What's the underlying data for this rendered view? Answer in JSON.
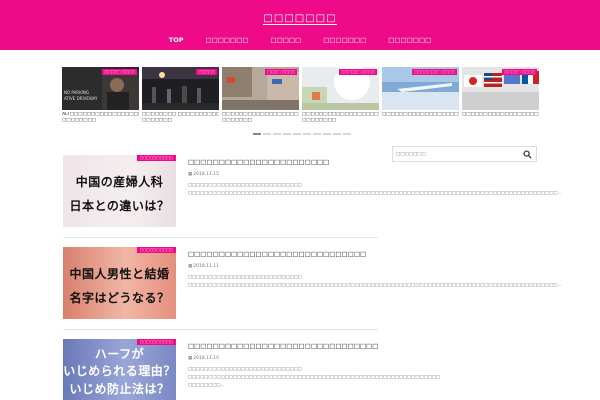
{
  "site": {
    "title": "□□□□□□□"
  },
  "nav": [
    "TOP",
    "□□□□□□□",
    "□□□□□",
    "□□□□□□□",
    "□□□□□□□"
  ],
  "slider": [
    {
      "category": "□□□□□ □□□□",
      "title": "ALT□□□□□□□□□□□□□□□□□□□□□",
      "title2": "□□□□□□□□",
      "overlay": "NO PARKING\nATIVE DRIVEWAY"
    },
    {
      "category": "□□□□□",
      "title": "□□□□□□□□ □□□□□□□□□□□□",
      "title2": "□□□□□□□"
    },
    {
      "category": "□□□□ □□□□",
      "title": "□□□□□□□□□□□□□□□□□□□□□□",
      "title2": "□□□□□□□"
    },
    {
      "category": "□□□□□□ □□□□",
      "title": "□□□□□□□□□□□□□□□□□□□□□□",
      "title2": "□□□□□□□□"
    },
    {
      "category": "□□□□□□□□ □□□□",
      "title": "□□□□□□□□□□□□□□□□□□□□□□",
      "title2": ""
    },
    {
      "category": "□□□□□ □□□□",
      "title": "□□□□□□□□□□□□□□□□□□□□□□",
      "title2": ""
    }
  ],
  "slider_dots": 10,
  "posts": [
    {
      "category": "□□□□□□□□□□",
      "title": "□□□□□□□□□□□□□□□□□□□□□□□",
      "date": "2018.11.15",
      "excerpt": "□□□□□□□□□□□□□□□□□□□□□□□□□□□□ □□□□□□□□□□□□□□□□□□□□□□□□□□□□□□□□□□□□□□□□□□□□□□□□□□□□□□□□□□□□□□□□□□□□□□□□□□□□□□□□□□□□□□□□□□□...",
      "thumb_lines": [
        "中国の産婦人科",
        "日本との違いは？"
      ]
    },
    {
      "category": "□□□□□□□□□□",
      "title": "□□□□□□□□□□□□□□□□□□□□□□□□□□□□□",
      "date": "2018.11.11",
      "excerpt": "□□□□□□□□□□□□□□□□□□□□□□□□□□□□ □□□□□□□□□□□□□□□□□□□□□□□□□□□□□□□□□□□□□□□□□□□□□□□□□□□□□□□□□□□□□□□□□□□□□□□□□□□□□□□□□□□□□□□□□□□...",
      "thumb_lines": [
        "中国人男性と結婚",
        "名字はどうなる？"
      ]
    },
    {
      "category": "□□□□□□□□□□",
      "title": "□□□□□□□□□□□□□□□□□□□□□□□□□□□□□□□",
      "date": "2018.11.10",
      "excerpt": "□□□□□□□□□□□□□□□□□□□□□□□□□□□□ □□□□□□□□□□□□□□□□□□□□□□□□□□□□□□□□□□□□□□□□□□□□□□□□□□□□□□□□□□□□□□ □□□□□□□□...",
      "thumb_lines": [
        "ハーフが",
        "いじめられる理由？",
        "いじめ防止法は？"
      ]
    }
  ],
  "search": {
    "placeholder": "□□□□□□□"
  },
  "colors": {
    "accent": "#ef0a8a"
  }
}
